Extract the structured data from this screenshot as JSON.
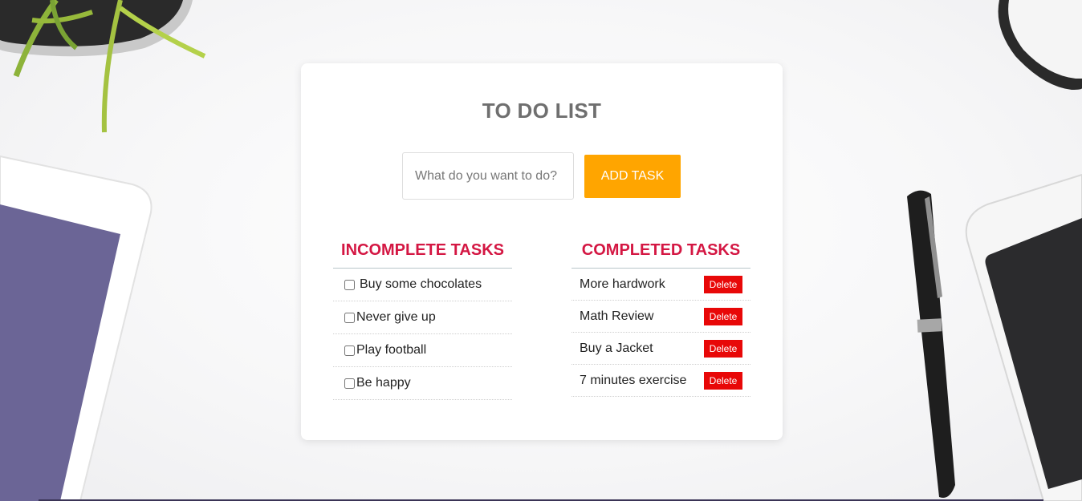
{
  "app": {
    "title": "TO DO LIST"
  },
  "form": {
    "placeholder": "What do you want to do?",
    "add_label": "ADD TASK",
    "accent": "#ffa500"
  },
  "incomplete": {
    "heading": "INCOMPLETE TASKS",
    "items": [
      {
        "label": "Buy some chocolates",
        "checked": false
      },
      {
        "label": "Never give up",
        "checked": false
      },
      {
        "label": "Play football",
        "checked": false
      },
      {
        "label": "Be happy",
        "checked": false
      }
    ]
  },
  "completed": {
    "heading": "COMPLETED TASKS",
    "delete_label": "Delete",
    "items": [
      {
        "label": "More hardwork"
      },
      {
        "label": "Math Review"
      },
      {
        "label": "Buy a Jacket"
      },
      {
        "label": "7 minutes exercise"
      }
    ]
  },
  "colors": {
    "heading": "#d41743",
    "title": "#6f6f6f",
    "delete": "#e80808"
  },
  "background_icons": [
    "plant-icon",
    "tablet-icon",
    "glasses-icon",
    "pen-icon",
    "phone-icon"
  ]
}
